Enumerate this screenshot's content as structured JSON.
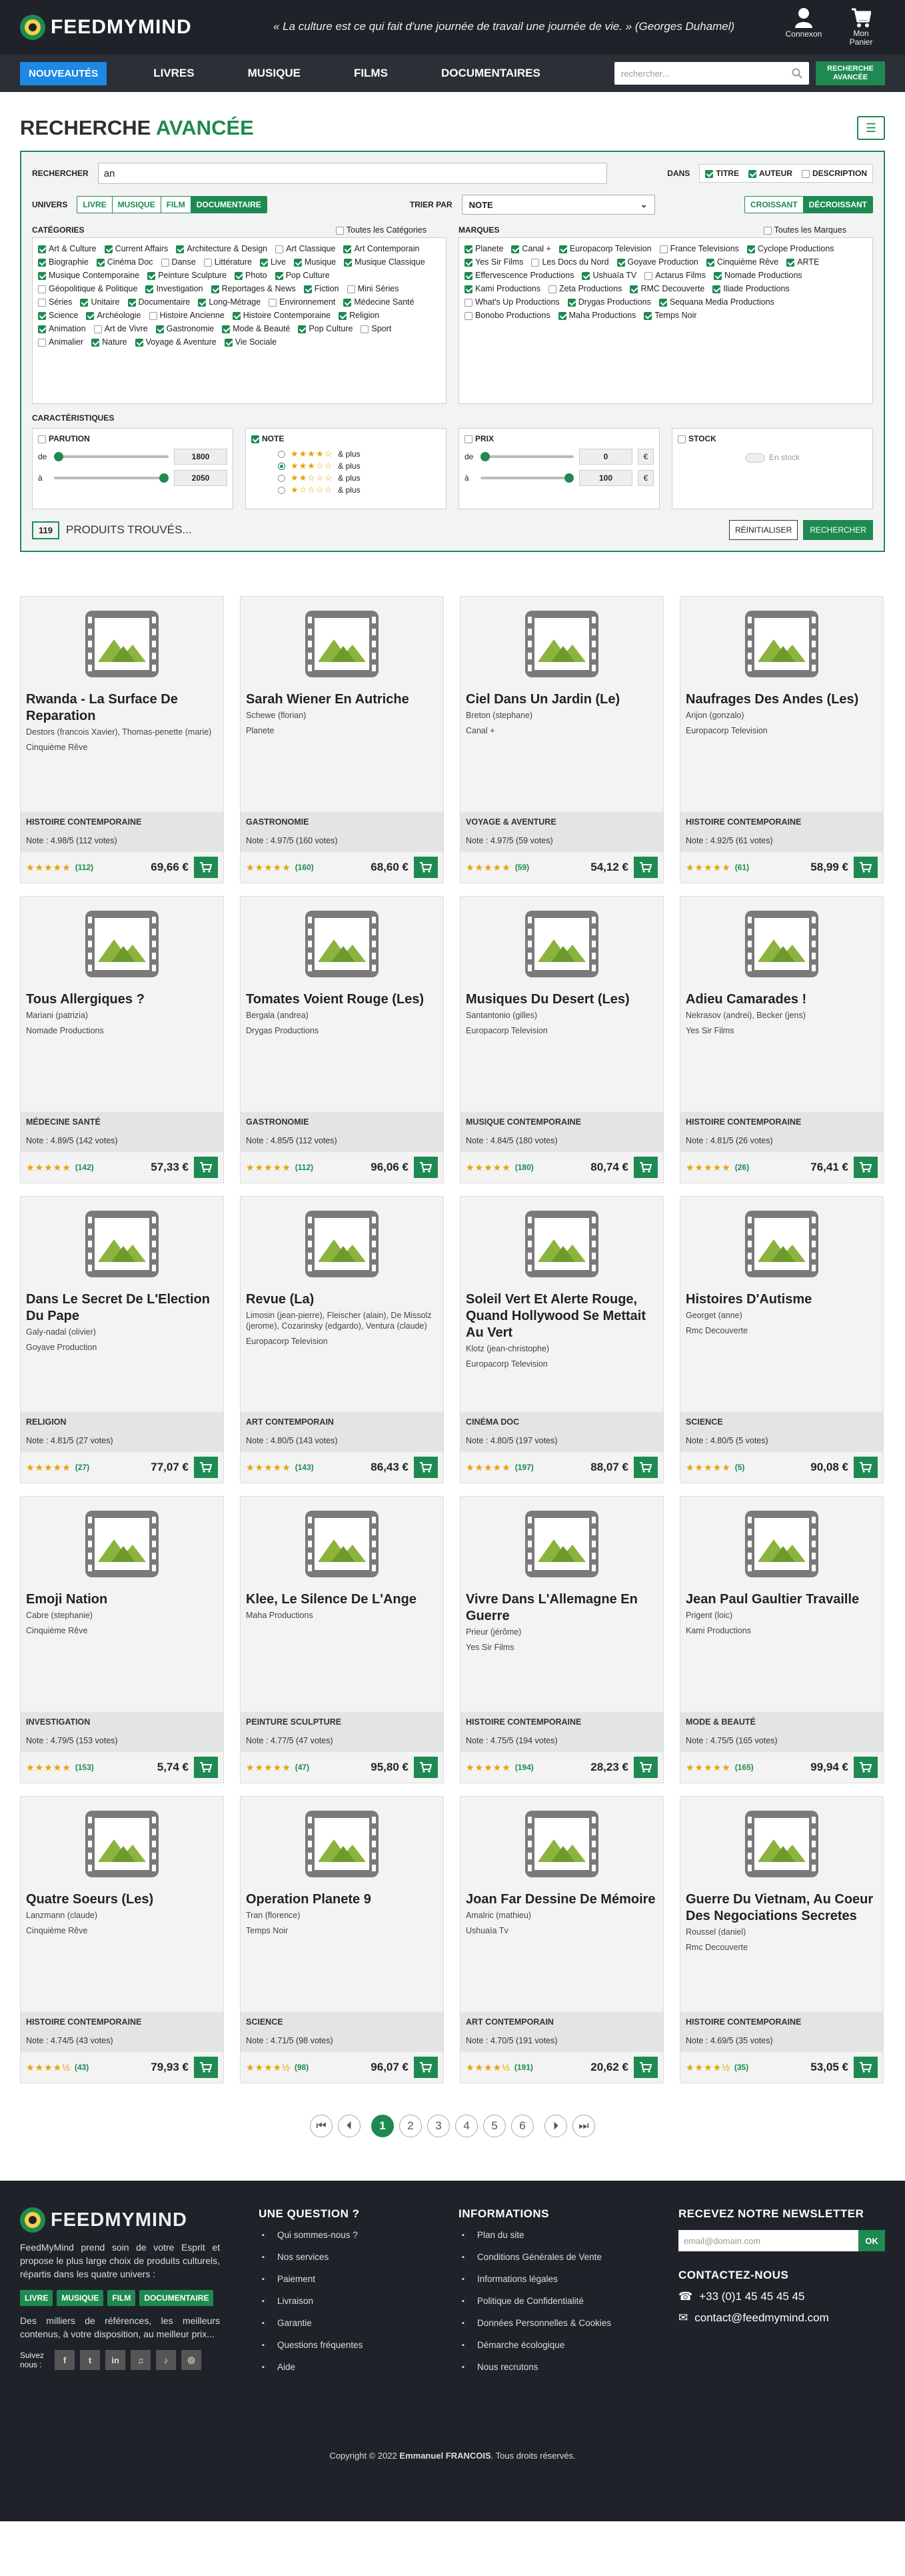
{
  "header": {
    "brand": "FEEDMYMIND",
    "quote": "« La culture est ce qui fait d'une journée de travail une journée de vie. » (Georges Duhamel)",
    "account_label": "Connexon",
    "cart_label": "Mon Panier"
  },
  "nav": {
    "new_label": "NOUVEAUTÉS",
    "items": [
      "LIVRES",
      "MUSIQUE",
      "FILMS",
      "DOCUMENTAIRES"
    ],
    "search_placeholder": "rechercher...",
    "advanced_label": "RECHERCHE AVANCÉE"
  },
  "page": {
    "title_a": "RECHERCHE",
    "title_b": "AVANCÉE"
  },
  "search": {
    "label": "RECHERCHER",
    "value": "an",
    "dans_label": "DANS",
    "dans": [
      {
        "label": "TITRE",
        "on": true
      },
      {
        "label": "AUTEUR",
        "on": true
      },
      {
        "label": "DESCRIPTION",
        "on": false
      }
    ],
    "univers_label": "UNIVERS",
    "univers": [
      {
        "label": "LIVRE",
        "active": false
      },
      {
        "label": "MUSIQUE",
        "active": false
      },
      {
        "label": "FILM",
        "active": false
      },
      {
        "label": "DOCUMENTAIRE",
        "active": true
      }
    ],
    "sort_label": "TRIER PAR",
    "sort_value": "NOTE",
    "order": [
      {
        "label": "CROISSANT",
        "active": false
      },
      {
        "label": "DÉCROISSANT",
        "active": true
      }
    ]
  },
  "categories": {
    "title": "CATÉGORIES",
    "all_label": "Toutes les Catégories",
    "items": [
      {
        "label": "Art & Culture",
        "on": true
      },
      {
        "label": "Current Affairs",
        "on": true
      },
      {
        "label": "Architecture & Design",
        "on": true
      },
      {
        "label": "Art Classique",
        "on": false
      },
      {
        "label": "Art Contemporain",
        "on": true
      },
      {
        "label": "Biographie",
        "on": true
      },
      {
        "label": "Cinéma Doc",
        "on": true
      },
      {
        "label": "Danse",
        "on": false
      },
      {
        "label": "Littérature",
        "on": false
      },
      {
        "label": "Live",
        "on": true
      },
      {
        "label": "Musique",
        "on": true
      },
      {
        "label": "Musique Classique",
        "on": true
      },
      {
        "label": "Musique Contemporaine",
        "on": true
      },
      {
        "label": "Peinture Sculpture",
        "on": true
      },
      {
        "label": "Photo",
        "on": true
      },
      {
        "label": "Pop Culture",
        "on": true
      },
      {
        "label": "Géopolitique & Politique",
        "on": false
      },
      {
        "label": "Investigation",
        "on": true
      },
      {
        "label": "Reportages & News",
        "on": true
      },
      {
        "label": "Fiction",
        "on": true
      },
      {
        "label": "Mini Séries",
        "on": false
      },
      {
        "label": "Séries",
        "on": false
      },
      {
        "label": "Unitaire",
        "on": true
      },
      {
        "label": "Documentaire",
        "on": true
      },
      {
        "label": "Long-Métrage",
        "on": true
      },
      {
        "label": "Environnement",
        "on": false
      },
      {
        "label": "Médecine Santé",
        "on": true
      },
      {
        "label": "Science",
        "on": true
      },
      {
        "label": "Archéologie",
        "on": true
      },
      {
        "label": "Histoire Ancienne",
        "on": false
      },
      {
        "label": "Histoire Contemporaine",
        "on": true
      },
      {
        "label": "Religion",
        "on": true
      },
      {
        "label": "Animation",
        "on": true
      },
      {
        "label": "Art de Vivre",
        "on": false
      },
      {
        "label": "Gastronomie",
        "on": true
      },
      {
        "label": "Mode & Beauté",
        "on": true
      },
      {
        "label": "Pop Culture",
        "on": true
      },
      {
        "label": "Sport",
        "on": false
      },
      {
        "label": "Animalier",
        "on": false
      },
      {
        "label": "Nature",
        "on": true
      },
      {
        "label": "Voyage & Aventure",
        "on": true
      },
      {
        "label": "Vie Sociale",
        "on": true
      }
    ]
  },
  "brands": {
    "title": "MARQUES",
    "all_label": "Toutes les Marques",
    "items": [
      {
        "label": "Planete",
        "on": true
      },
      {
        "label": "Canal +",
        "on": true
      },
      {
        "label": "Europacorp Television",
        "on": true
      },
      {
        "label": "France Televisions",
        "on": false
      },
      {
        "label": "Cyclope Productions",
        "on": true
      },
      {
        "label": "Yes Sir Films",
        "on": true
      },
      {
        "label": "Les Docs du Nord",
        "on": false
      },
      {
        "label": "Goyave Production",
        "on": true
      },
      {
        "label": "Cinquième Rêve",
        "on": true
      },
      {
        "label": "ARTE",
        "on": true
      },
      {
        "label": "Effervescence Productions",
        "on": true
      },
      {
        "label": "Ushuaïa TV",
        "on": true
      },
      {
        "label": "Actarus Films",
        "on": false
      },
      {
        "label": "Nomade Productions",
        "on": true
      },
      {
        "label": "Kami Productions",
        "on": true
      },
      {
        "label": "Zeta Productions",
        "on": false
      },
      {
        "label": "RMC Decouverte",
        "on": true
      },
      {
        "label": "Iliade Productions",
        "on": true
      },
      {
        "label": "What's Up Productions",
        "on": false
      },
      {
        "label": "Drygas Productions",
        "on": true
      },
      {
        "label": "Sequana Media Productions",
        "on": true
      },
      {
        "label": "Bonobo Productions",
        "on": false
      },
      {
        "label": "Maha Productions",
        "on": true
      },
      {
        "label": "Temps Noir",
        "on": true
      }
    ]
  },
  "caract": {
    "title": "CARACTÉRISTIQUES",
    "parution": {
      "label": "PARUTION",
      "de_label": "de",
      "de_value": "1800",
      "a_label": "à",
      "a_value": "2050"
    },
    "note": {
      "label": "NOTE",
      "options": [
        {
          "stars": "★★★★☆",
          "label": "& plus",
          "selected": false
        },
        {
          "stars": "★★★☆☆",
          "label": "& plus",
          "selected": true
        },
        {
          "stars": "★★☆☆☆",
          "label": "& plus",
          "selected": false
        },
        {
          "stars": "★☆☆☆☆",
          "label": "& plus",
          "selected": false
        }
      ]
    },
    "prix": {
      "label": "PRIX",
      "de_label": "de",
      "de_value": "0",
      "a_label": "à",
      "a_value": "100",
      "unit": "€"
    },
    "stock": {
      "label": "STOCK",
      "toggle_label": "En stock"
    }
  },
  "results": {
    "count": "119",
    "text": "PRODUITS TROUVÉS...",
    "reset_label": "RÉINITIALISER",
    "search_label": "RECHERCHER"
  },
  "products": [
    {
      "title": "Rwanda - La Surface De Reparation",
      "authors": "Destors (francois Xavier), Thomas-penette (marie)",
      "prod": "Cinquième Rêve",
      "cat": "HISTOIRE CONTEMPORAINE",
      "note": "Note : 4.98/5 (112 votes)",
      "stars": "★★★★★",
      "votes": "(112)",
      "price": "69,66 €"
    },
    {
      "title": "Sarah Wiener En Autriche",
      "authors": "Schewe (florian)",
      "prod": "Planete",
      "cat": "GASTRONOMIE",
      "note": "Note : 4.97/5 (160 votes)",
      "stars": "★★★★★",
      "votes": "(160)",
      "price": "68,60 €"
    },
    {
      "title": "Ciel Dans Un Jardin (Le)",
      "authors": "Breton (stephane)",
      "prod": "Canal +",
      "cat": "VOYAGE & AVENTURE",
      "note": "Note : 4.97/5 (59 votes)",
      "stars": "★★★★★",
      "votes": "(59)",
      "price": "54,12 €"
    },
    {
      "title": "Naufrages Des Andes (Les)",
      "authors": "Arijon (gonzalo)",
      "prod": "Europacorp Television",
      "cat": "HISTOIRE CONTEMPORAINE",
      "note": "Note : 4.92/5 (61 votes)",
      "stars": "★★★★★",
      "votes": "(61)",
      "price": "58,99 €"
    },
    {
      "title": "Tous Allergiques ?",
      "authors": "Mariani (patrizia)",
      "prod": "Nomade Productions",
      "cat": "MÉDECINE SANTÉ",
      "note": "Note : 4.89/5 (142 votes)",
      "stars": "★★★★★",
      "votes": "(142)",
      "price": "57,33 €"
    },
    {
      "title": "Tomates Voient Rouge (Les)",
      "authors": "Bergala (andrea)",
      "prod": "Drygas Productions",
      "cat": "GASTRONOMIE",
      "note": "Note : 4.85/5 (112 votes)",
      "stars": "★★★★★",
      "votes": "(112)",
      "price": "96,06 €"
    },
    {
      "title": "Musiques Du Desert (Les)",
      "authors": "Santantonio (gilles)",
      "prod": "Europacorp Television",
      "cat": "MUSIQUE CONTEMPORAINE",
      "note": "Note : 4.84/5 (180 votes)",
      "stars": "★★★★★",
      "votes": "(180)",
      "price": "80,74 €"
    },
    {
      "title": "Adieu Camarades !",
      "authors": "Nekrasov (andrei), Becker (jens)",
      "prod": "Yes Sir Films",
      "cat": "HISTOIRE CONTEMPORAINE",
      "note": "Note : 4.81/5 (26 votes)",
      "stars": "★★★★★",
      "votes": "(26)",
      "price": "76,41 €"
    },
    {
      "title": "Dans Le Secret De L'Election Du Pape",
      "authors": "Galy-nadal (olivier)",
      "prod": "Goyave Production",
      "cat": "RELIGION",
      "note": "Note : 4.81/5 (27 votes)",
      "stars": "★★★★★",
      "votes": "(27)",
      "price": "77,07 €"
    },
    {
      "title": "Revue (La)",
      "authors": "Limosin (jean-pierre), Fleischer (alain), De Missolz (jerome), Cozarinsky (edgardo), Ventura (claude)",
      "prod": "Europacorp Television",
      "cat": "ART CONTEMPORAIN",
      "note": "Note : 4.80/5 (143 votes)",
      "stars": "★★★★★",
      "votes": "(143)",
      "price": "86,43 €"
    },
    {
      "title": "Soleil Vert Et Alerte Rouge, Quand Hollywood Se Mettait Au Vert",
      "authors": "Klotz (jean-christophe)",
      "prod": "Europacorp Television",
      "cat": "CINÉMA DOC",
      "note": "Note : 4.80/5 (197 votes)",
      "stars": "★★★★★",
      "votes": "(197)",
      "price": "88,07 €"
    },
    {
      "title": "Histoires D'Autisme",
      "authors": "Georget (anne)",
      "prod": "Rmc Decouverte",
      "cat": "SCIENCE",
      "note": "Note : 4.80/5 (5 votes)",
      "stars": "★★★★★",
      "votes": "(5)",
      "price": "90,08 €"
    },
    {
      "title": "Emoji Nation",
      "authors": "Cabre (stephanie)",
      "prod": "Cinquième Rêve",
      "cat": "INVESTIGATION",
      "note": "Note : 4.79/5 (153 votes)",
      "stars": "★★★★★",
      "votes": "(153)",
      "price": "5,74 €"
    },
    {
      "title": "Klee, Le Silence De L'Ange",
      "authors": "Maha Productions",
      "prod": "",
      "cat": "PEINTURE SCULPTURE",
      "note": "Note : 4.77/5 (47 votes)",
      "stars": "★★★★★",
      "votes": "(47)",
      "price": "95,80 €"
    },
    {
      "title": "Vivre Dans L'Allemagne En Guerre",
      "authors": "Prieur (jérôme)",
      "prod": "Yes Sir Films",
      "cat": "HISTOIRE CONTEMPORAINE",
      "note": "Note : 4.75/5 (194 votes)",
      "stars": "★★★★★",
      "votes": "(194)",
      "price": "28,23 €"
    },
    {
      "title": "Jean Paul Gaultier Travaille",
      "authors": "Prigent (loic)",
      "prod": "Kami Productions",
      "cat": "MODE & BEAUTÉ",
      "note": "Note : 4.75/5 (165 votes)",
      "stars": "★★★★★",
      "votes": "(165)",
      "price": "99,94 €"
    },
    {
      "title": "Quatre Soeurs (Les)",
      "authors": "Lanzmann (claude)",
      "prod": "Cinquième Rêve",
      "cat": "HISTOIRE CONTEMPORAINE",
      "note": "Note : 4.74/5 (43 votes)",
      "stars": "★★★★½",
      "votes": "(43)",
      "price": "79,93 €"
    },
    {
      "title": "Operation Planete 9",
      "authors": "Tran (florence)",
      "prod": "Temps Noir",
      "cat": "SCIENCE",
      "note": "Note : 4.71/5 (98 votes)",
      "stars": "★★★★½",
      "votes": "(98)",
      "price": "96,07 €"
    },
    {
      "title": "Joan Far Dessine De Mémoire",
      "authors": "Amalric (mathieu)",
      "prod": "Ushuaïa Tv",
      "cat": "ART CONTEMPORAIN",
      "note": "Note : 4.70/5 (191 votes)",
      "stars": "★★★★½",
      "votes": "(191)",
      "price": "20,62 €"
    },
    {
      "title": "Guerre Du Vietnam, Au Coeur Des Negociations Secretes",
      "authors": "Roussel (daniel)",
      "prod": "Rmc Decouverte",
      "cat": "HISTOIRE CONTEMPORAINE",
      "note": "Note : 4.69/5 (35 votes)",
      "stars": "★★★★½",
      "votes": "(35)",
      "price": "53,05 €"
    }
  ],
  "pagination": {
    "pages": [
      "1",
      "2",
      "3",
      "4",
      "5",
      "6"
    ],
    "current": "1"
  },
  "footer": {
    "brand": "FEEDMYMIND",
    "desc1": "FeedMyMind prend soin de votre Esprit et propose le plus large choix de produits culturels, répartis dans les quatre univers :",
    "tags": [
      "LIVRE",
      "MUSIQUE",
      "FILM",
      "DOCUMENTAIRE"
    ],
    "desc2": "Des milliers de références, les meilleurs contenus, à votre disposition, au meilleur prix...",
    "follow": "Suivez nous :",
    "social": [
      "f",
      "t",
      "in",
      "♫",
      "♪",
      "◎"
    ],
    "col2_title": "UNE QUESTION ?",
    "col2": [
      "Qui sommes-nous ?",
      "Nos services",
      "Paiement",
      "Livraison",
      "Garantie",
      "Questions fréquentes",
      "Aide"
    ],
    "col3_title": "INFORMATIONS",
    "col3": [
      "Plan du site",
      "Conditions Générales de Vente",
      "Informations légales",
      "Politique de Confidentialité",
      "Données Personnelles & Cookies",
      "Démarche écologique",
      "Nous recrutons"
    ],
    "news_title": "RECEVEZ NOTRE NEWSLETTER",
    "news_placeholder": "email@domain.com",
    "news_ok": "OK",
    "contact_title": "CONTACTEZ-NOUS",
    "phone": "+33 (0)1 45 45 45 45",
    "email": "contact@feedmymind.com",
    "copyright_pre": "Copyright © 2022",
    "copyright_name": "Emmanuel FRANCOIS",
    "copyright_post": ". Tous droits réservés."
  }
}
